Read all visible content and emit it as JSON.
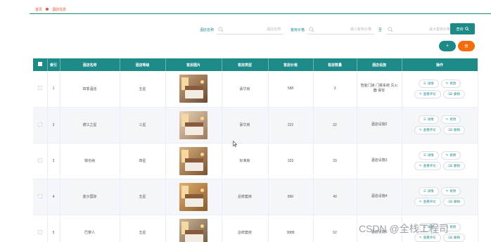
{
  "breadcrumb": {
    "home": "首页",
    "current": "酒店信息"
  },
  "search": {
    "hotel_name_label": "酒店名称",
    "hotel_name_placeholder": "酒店名称",
    "price_label": "客房价格",
    "min_price_placeholder": "最小客房价格",
    "range_sep": "至",
    "max_price_placeholder": "最大客房价格",
    "search_button": "查询"
  },
  "actions": {
    "add": "+",
    "delete": "册"
  },
  "table": {
    "headers": [
      "索引",
      "酒店名称",
      "酒店等级",
      "客房图片",
      "客房类型",
      "客房价格",
      "客房数量",
      "酒店设施",
      "操作"
    ],
    "op_labels": {
      "detail": "详情",
      "edit": "修改",
      "review": "查看评论",
      "delete": "删除"
    },
    "rows": [
      {
        "index": "1",
        "name": "四季酒店",
        "level": "五星",
        "type": "豪华房",
        "price": "588",
        "count": "3",
        "facility": "智能门锁 门禁系统 灭火器 保安"
      },
      {
        "index": "2",
        "name": "德江之星",
        "level": "三星",
        "type": "豪华房",
        "price": "222",
        "count": "22",
        "facility": "酒店设施2"
      },
      {
        "index": "3",
        "name": "锦也纳",
        "level": "四星",
        "type": "标准房",
        "price": "333",
        "count": "33",
        "facility": "酒店设施3"
      },
      {
        "index": "4",
        "name": "金沙国际",
        "level": "五星",
        "type": "总统套房",
        "price": "890",
        "count": "40",
        "facility": "酒店设施4"
      },
      {
        "index": "5",
        "name": "巴黎人",
        "level": "五星",
        "type": "总统套房",
        "price": "3888",
        "count": "52",
        "facility": "酒店设施5"
      }
    ]
  },
  "watermark": "CSDN @全栈工程司",
  "colors": {
    "primary": "#1e8a88",
    "danger": "#f56c0c",
    "crumb": "#e2563b"
  }
}
